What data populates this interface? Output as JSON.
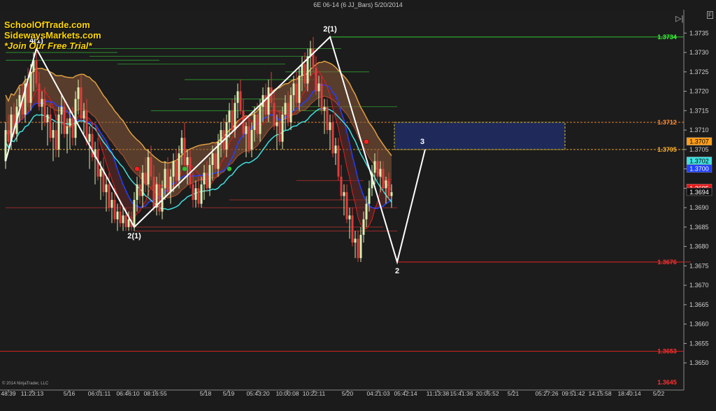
{
  "window": {
    "title": "6E 06-14 (6 JJ_Bars)  5/20/2014"
  },
  "branding": {
    "line1": "SchoolOfTrade.com",
    "line2": "SidewaysMarkets.com",
    "line3": "*Join Our Free Trial*"
  },
  "copyright": "© 2014 NinjaTrader, LLC",
  "icons": {
    "scale_toggle": "play-bar-icon",
    "properties": "f-box-icon"
  },
  "chart_data": {
    "type": "candlestick",
    "instrument": "6E 06-14",
    "bar_type": "6 JJ_Bars",
    "date": "5/20/2014",
    "ylim": [
      1.3643,
      1.3741
    ],
    "price_axis_ticks": [
      1.365,
      1.3655,
      1.366,
      1.3665,
      1.367,
      1.3675,
      1.368,
      1.3685,
      1.369,
      1.3695,
      1.37,
      1.3705,
      1.371,
      1.3715,
      1.372,
      1.3725,
      1.373,
      1.3735
    ],
    "time_labels": [
      "48:39",
      "11:23:13",
      "5/16",
      "06:01:11",
      "06:46:10",
      "08:16:55",
      "5/18",
      "5/19",
      "05:43:20",
      "10:00:08",
      "10:22:11",
      "5/20",
      "04:21:03",
      "05:42:14",
      "11:13:38",
      "15:41:36",
      "20:05:52",
      "5/21",
      "05:27:26",
      "09:51:42",
      "14:15:58",
      "18:40:14",
      "5/22"
    ],
    "price_markers": [
      {
        "label": "1.3734",
        "value": 1.3734,
        "color": "#33ff33",
        "style": "text"
      },
      {
        "label": "1.3712",
        "value": 1.3712,
        "color": "#ff8c3a",
        "style": "text"
      },
      {
        "label": "1.3707",
        "value": 1.3707,
        "color": "#ff9e1a",
        "style": "box"
      },
      {
        "label": "1.3705",
        "value": 1.3705,
        "color": "#ffb030",
        "style": "text"
      },
      {
        "label": "1.3702",
        "value": 1.3702,
        "color": "#40e0e0",
        "style": "box"
      },
      {
        "label": "1.3700",
        "value": 1.37,
        "color": "#2040ff",
        "style": "box"
      },
      {
        "label": "1.3695",
        "value": 1.3695,
        "color": "#e81818",
        "style": "box"
      },
      {
        "label": "1.3694",
        "value": 1.3694,
        "color": "#101010",
        "style": "box"
      },
      {
        "label": "1.3676",
        "value": 1.3676,
        "color": "#ff3030",
        "style": "text"
      },
      {
        "label": "1.3653",
        "value": 1.3653,
        "color": "#ff3030",
        "style": "text"
      },
      {
        "label": "1.3645",
        "value": 1.3645,
        "color": "#ff3030",
        "style": "text"
      }
    ],
    "zigzag": [
      {
        "bar": 0,
        "price": 1.3702
      },
      {
        "bar": 11,
        "price": 1.3731
      },
      {
        "bar": 46,
        "price": 1.3685
      },
      {
        "bar": 116,
        "price": 1.3734
      },
      {
        "bar": 140,
        "price": 1.3676
      },
      {
        "bar": 150,
        "price": 1.3705
      }
    ],
    "swing_labels": [
      {
        "text": "4(1)",
        "bar": 11,
        "price": 1.3731,
        "pos": "above"
      },
      {
        "text": "2(1)",
        "bar": 46,
        "price": 1.3685,
        "pos": "below"
      },
      {
        "text": "2(1)",
        "bar": 116,
        "price": 1.3734,
        "pos": "above"
      },
      {
        "text": "2",
        "bar": 140,
        "price": 1.3676,
        "pos": "below"
      },
      {
        "text": "3",
        "bar": 149,
        "price": 1.3705,
        "pos": "above"
      }
    ],
    "supply_zone": {
      "from_bar": 139,
      "to_bar": 200,
      "top": 1.3712,
      "bottom": 1.3705
    },
    "signal_dots": [
      {
        "bar": 47,
        "price": 1.37,
        "color": "red"
      },
      {
        "bar": 64,
        "price": 1.37,
        "color": "green"
      },
      {
        "bar": 80,
        "price": 1.37,
        "color": "green"
      },
      {
        "bar": 129,
        "price": 1.3707,
        "color": "red"
      }
    ],
    "candles": [
      [
        1.3702,
        1.3712,
        1.37,
        1.371
      ],
      [
        1.371,
        1.3714,
        1.3706,
        1.3707
      ],
      [
        1.3707,
        1.3716,
        1.3705,
        1.3714
      ],
      [
        1.3714,
        1.3717,
        1.3708,
        1.3709
      ],
      [
        1.3709,
        1.3718,
        1.3707,
        1.3716
      ],
      [
        1.3716,
        1.3721,
        1.3712,
        1.3719
      ],
      [
        1.3719,
        1.3722,
        1.3713,
        1.3714
      ],
      [
        1.3714,
        1.3724,
        1.3712,
        1.3722
      ],
      [
        1.3722,
        1.3726,
        1.3716,
        1.3717
      ],
      [
        1.3717,
        1.3727,
        1.3715,
        1.3725
      ],
      [
        1.3725,
        1.373,
        1.372,
        1.3728
      ],
      [
        1.3728,
        1.3731,
        1.3721,
        1.3722
      ],
      [
        1.3722,
        1.3725,
        1.3715,
        1.3716
      ],
      [
        1.3716,
        1.372,
        1.371,
        1.3718
      ],
      [
        1.3718,
        1.3721,
        1.3711,
        1.3712
      ],
      [
        1.3712,
        1.3716,
        1.3706,
        1.3714
      ],
      [
        1.3714,
        1.3717,
        1.3707,
        1.3708
      ],
      [
        1.3708,
        1.3712,
        1.3702,
        1.371
      ],
      [
        1.371,
        1.3714,
        1.3703,
        1.3705
      ],
      [
        1.3705,
        1.3716,
        1.3703,
        1.3714
      ],
      [
        1.3714,
        1.3719,
        1.3709,
        1.3716
      ],
      [
        1.3716,
        1.3718,
        1.3708,
        1.3709
      ],
      [
        1.3709,
        1.3713,
        1.3704,
        1.3711
      ],
      [
        1.3711,
        1.3715,
        1.3705,
        1.3713
      ],
      [
        1.3713,
        1.3716,
        1.3706,
        1.3708
      ],
      [
        1.3708,
        1.372,
        1.3706,
        1.3718
      ],
      [
        1.3718,
        1.3723,
        1.3714,
        1.3721
      ],
      [
        1.3721,
        1.3724,
        1.3712,
        1.3713
      ],
      [
        1.3713,
        1.3717,
        1.3709,
        1.3715
      ],
      [
        1.3715,
        1.3718,
        1.3706,
        1.3707
      ],
      [
        1.3707,
        1.3711,
        1.37,
        1.3709
      ],
      [
        1.3709,
        1.3712,
        1.3702,
        1.3703
      ],
      [
        1.3703,
        1.3707,
        1.3696,
        1.3705
      ],
      [
        1.3705,
        1.3708,
        1.3697,
        1.3698
      ],
      [
        1.3698,
        1.3702,
        1.3692,
        1.37
      ],
      [
        1.37,
        1.3703,
        1.3693,
        1.3694
      ],
      [
        1.3694,
        1.3698,
        1.3689,
        1.3696
      ],
      [
        1.3696,
        1.3699,
        1.3689,
        1.369
      ],
      [
        1.369,
        1.3694,
        1.3686,
        1.3692
      ],
      [
        1.3692,
        1.3695,
        1.3686,
        1.3687
      ],
      [
        1.3687,
        1.3691,
        1.3684,
        1.3689
      ],
      [
        1.3689,
        1.3692,
        1.3685,
        1.3686
      ],
      [
        1.3686,
        1.369,
        1.3684,
        1.3688
      ],
      [
        1.3688,
        1.369,
        1.3684,
        1.3685
      ],
      [
        1.3685,
        1.3689,
        1.3684,
        1.3687
      ],
      [
        1.3687,
        1.3689,
        1.3684,
        1.3685
      ],
      [
        1.3685,
        1.3694,
        1.3684,
        1.3692
      ],
      [
        1.3692,
        1.3698,
        1.3689,
        1.3696
      ],
      [
        1.3696,
        1.37,
        1.3691,
        1.3693
      ],
      [
        1.3693,
        1.3701,
        1.369,
        1.3699
      ],
      [
        1.3699,
        1.3703,
        1.3694,
        1.3696
      ],
      [
        1.3696,
        1.3705,
        1.3693,
        1.3703
      ],
      [
        1.3703,
        1.3706,
        1.3697,
        1.3698
      ],
      [
        1.3698,
        1.3701,
        1.3689,
        1.369
      ],
      [
        1.369,
        1.3698,
        1.3688,
        1.3696
      ],
      [
        1.3696,
        1.3699,
        1.3688,
        1.3689
      ],
      [
        1.3689,
        1.3697,
        1.3687,
        1.3695
      ],
      [
        1.3695,
        1.3702,
        1.3692,
        1.37
      ],
      [
        1.37,
        1.3703,
        1.3693,
        1.3694
      ],
      [
        1.3694,
        1.37,
        1.3691,
        1.3698
      ],
      [
        1.3698,
        1.3704,
        1.3694,
        1.3702
      ],
      [
        1.3702,
        1.3705,
        1.3696,
        1.3697
      ],
      [
        1.3697,
        1.3706,
        1.3695,
        1.3704
      ],
      [
        1.3704,
        1.371,
        1.3701,
        1.3708
      ],
      [
        1.3708,
        1.3712,
        1.37,
        1.3701
      ],
      [
        1.3701,
        1.3705,
        1.3696,
        1.3703
      ],
      [
        1.3703,
        1.3705,
        1.3695,
        1.3696
      ],
      [
        1.3696,
        1.3699,
        1.369,
        1.3692
      ],
      [
        1.3692,
        1.3697,
        1.369,
        1.3695
      ],
      [
        1.3695,
        1.3698,
        1.369,
        1.3691
      ],
      [
        1.3691,
        1.3698,
        1.369,
        1.3696
      ],
      [
        1.3696,
        1.3701,
        1.3692,
        1.3699
      ],
      [
        1.3699,
        1.3702,
        1.3694,
        1.3695
      ],
      [
        1.3695,
        1.3703,
        1.3693,
        1.3701
      ],
      [
        1.3701,
        1.3706,
        1.3697,
        1.3704
      ],
      [
        1.3704,
        1.3707,
        1.3699,
        1.37
      ],
      [
        1.37,
        1.3709,
        1.3698,
        1.3707
      ],
      [
        1.3707,
        1.3712,
        1.3703,
        1.371
      ],
      [
        1.371,
        1.3713,
        1.3704,
        1.3705
      ],
      [
        1.3705,
        1.3714,
        1.3703,
        1.3712
      ],
      [
        1.3712,
        1.3717,
        1.3708,
        1.3715
      ],
      [
        1.3715,
        1.3718,
        1.3709,
        1.371
      ],
      [
        1.371,
        1.3719,
        1.3708,
        1.3717
      ],
      [
        1.3717,
        1.3722,
        1.3713,
        1.372
      ],
      [
        1.372,
        1.3723,
        1.3714,
        1.3715
      ],
      [
        1.3715,
        1.3718,
        1.3708,
        1.3709
      ],
      [
        1.3709,
        1.3712,
        1.3703,
        1.3711
      ],
      [
        1.3711,
        1.3714,
        1.3704,
        1.3705
      ],
      [
        1.3705,
        1.3712,
        1.3703,
        1.371
      ],
      [
        1.371,
        1.3716,
        1.3707,
        1.3714
      ],
      [
        1.3714,
        1.3717,
        1.3708,
        1.3709
      ],
      [
        1.3709,
        1.3718,
        1.3707,
        1.3716
      ],
      [
        1.3716,
        1.3721,
        1.3712,
        1.3719
      ],
      [
        1.3719,
        1.3722,
        1.3713,
        1.3714
      ],
      [
        1.3714,
        1.3723,
        1.3712,
        1.3721
      ],
      [
        1.3721,
        1.3725,
        1.3716,
        1.3717
      ],
      [
        1.3717,
        1.372,
        1.371,
        1.3711
      ],
      [
        1.3711,
        1.3714,
        1.3705,
        1.3712
      ],
      [
        1.3712,
        1.3715,
        1.3706,
        1.3707
      ],
      [
        1.3707,
        1.3716,
        1.3705,
        1.3714
      ],
      [
        1.3714,
        1.3719,
        1.371,
        1.3717
      ],
      [
        1.3717,
        1.372,
        1.3711,
        1.3712
      ],
      [
        1.3712,
        1.3721,
        1.371,
        1.3719
      ],
      [
        1.3719,
        1.3724,
        1.3715,
        1.3722
      ],
      [
        1.3722,
        1.3725,
        1.3716,
        1.3717
      ],
      [
        1.3717,
        1.3726,
        1.3715,
        1.3724
      ],
      [
        1.3724,
        1.3729,
        1.372,
        1.3727
      ],
      [
        1.3727,
        1.373,
        1.3721,
        1.3722
      ],
      [
        1.3722,
        1.3731,
        1.372,
        1.3729
      ],
      [
        1.3729,
        1.3733,
        1.3724,
        1.3731
      ],
      [
        1.3731,
        1.3734,
        1.3725,
        1.3726
      ],
      [
        1.3726,
        1.3729,
        1.3719,
        1.372
      ],
      [
        1.372,
        1.3724,
        1.3716,
        1.3722
      ],
      [
        1.3722,
        1.3724,
        1.3714,
        1.3715
      ],
      [
        1.3715,
        1.3718,
        1.3709,
        1.3716
      ],
      [
        1.3716,
        1.3718,
        1.3709,
        1.371
      ],
      [
        1.371,
        1.3714,
        1.3705,
        1.3712
      ],
      [
        1.3712,
        1.3714,
        1.3703,
        1.3704
      ],
      [
        1.3704,
        1.3708,
        1.3701,
        1.3706
      ],
      [
        1.3706,
        1.3708,
        1.3697,
        1.3698
      ],
      [
        1.3698,
        1.3701,
        1.3692,
        1.3693
      ],
      [
        1.3693,
        1.3696,
        1.3688,
        1.3694
      ],
      [
        1.3694,
        1.3696,
        1.3686,
        1.3687
      ],
      [
        1.3687,
        1.369,
        1.3682,
        1.3688
      ],
      [
        1.3688,
        1.369,
        1.368,
        1.3681
      ],
      [
        1.3681,
        1.3684,
        1.3677,
        1.3682
      ],
      [
        1.3682,
        1.3684,
        1.3676,
        1.3677
      ],
      [
        1.3677,
        1.3685,
        1.3676,
        1.3683
      ],
      [
        1.3683,
        1.3689,
        1.3681,
        1.3687
      ],
      [
        1.3687,
        1.3693,
        1.3685,
        1.3691
      ],
      [
        1.3691,
        1.3697,
        1.3689,
        1.3695
      ],
      [
        1.3695,
        1.3701,
        1.3693,
        1.3699
      ],
      [
        1.3699,
        1.3704,
        1.3696,
        1.3702
      ],
      [
        1.3702,
        1.3705,
        1.3697,
        1.3698
      ],
      [
        1.3698,
        1.3702,
        1.3694,
        1.37
      ],
      [
        1.37,
        1.3702,
        1.3694,
        1.3695
      ],
      [
        1.3695,
        1.3698,
        1.3691,
        1.3697
      ],
      [
        1.3697,
        1.3699,
        1.3692,
        1.3693
      ],
      [
        1.3693,
        1.3696,
        1.369,
        1.3694
      ]
    ]
  }
}
